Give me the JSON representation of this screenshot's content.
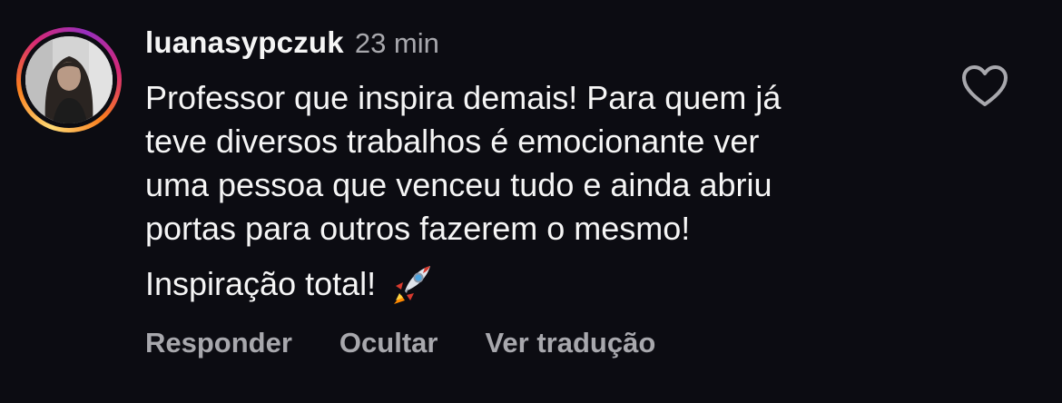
{
  "comment": {
    "username": "luanasypczuk",
    "time": "23 min",
    "text_lines": "Professor que inspira demais! Para quem já\nteve diversos trabalhos é emocionante ver\numa pessoa que venceu tudo e ainda abriu\nportas para outros fazerem o mesmo!",
    "text_tail": "Inspiração total!",
    "emoji_icon": "rocket-icon",
    "like_icon": "heart-outline-icon"
  },
  "actions": {
    "reply_label": "Responder",
    "hide_label": "Ocultar",
    "translate_label": "Ver tradução"
  },
  "colors": {
    "background": "#0c0c12",
    "text_primary": "#f5f5f5",
    "text_secondary": "#a8a8ad"
  }
}
